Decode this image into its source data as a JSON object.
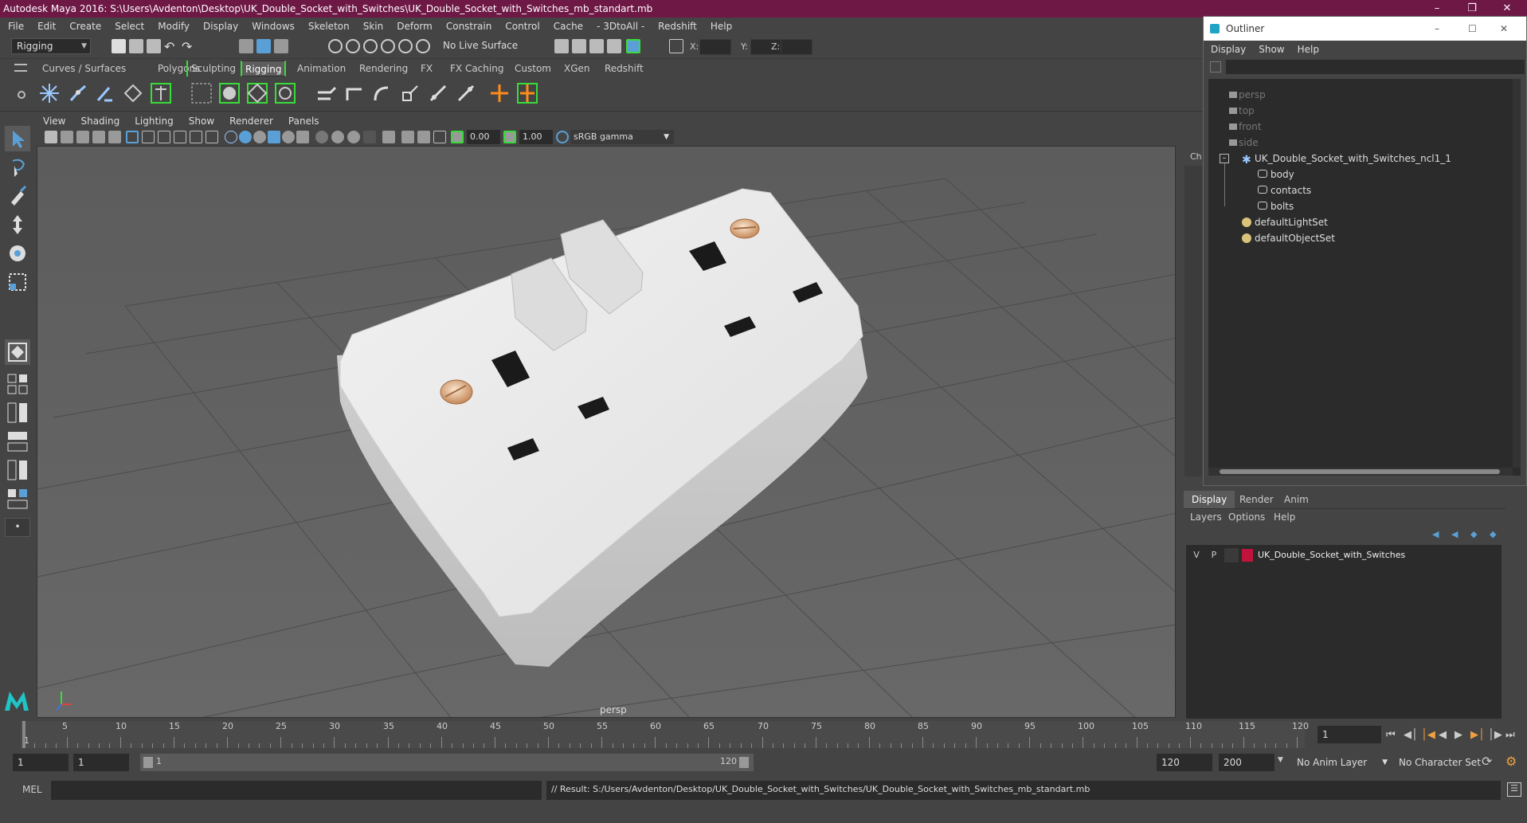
{
  "window": {
    "title": "Autodesk Maya 2016: S:\\Users\\Avdenton\\Desktop\\UK_Double_Socket_with_Switches\\UK_Double_Socket_with_Switches_mb_standart.mb"
  },
  "menubar": [
    "File",
    "Edit",
    "Create",
    "Select",
    "Modify",
    "Display",
    "Windows",
    "Skeleton",
    "Skin",
    "Deform",
    "Constrain",
    "Control",
    "Cache",
    "- 3DtoAll -",
    "Redshift",
    "Help"
  ],
  "statusline": {
    "mode": "Rigging",
    "live_surface": "No Live Surface",
    "x_label": "X:",
    "y_label": "Y:",
    "z_label": "Z:"
  },
  "shelf": {
    "tabs": [
      "Curves / Surfaces",
      "Polygons",
      "Sculpting",
      "Rigging",
      "Animation",
      "Rendering",
      "FX",
      "FX Caching",
      "Custom",
      "XGen",
      "Redshift"
    ],
    "active": "Rigging"
  },
  "panel": {
    "menu": [
      "View",
      "Shading",
      "Lighting",
      "Show",
      "Renderer",
      "Panels"
    ],
    "exposure": "0.00",
    "gamma": "1.00",
    "color_space": "sRGB gamma",
    "camera_label": "persp"
  },
  "outliner": {
    "title": "Outliner",
    "menu": [
      "Display",
      "Show",
      "Help"
    ],
    "items": [
      {
        "label": "persp",
        "dim": true,
        "indent": 0
      },
      {
        "label": "top",
        "dim": true,
        "indent": 0
      },
      {
        "label": "front",
        "dim": true,
        "indent": 0
      },
      {
        "label": "side",
        "dim": true,
        "indent": 0
      },
      {
        "label": "UK_Double_Socket_with_Switches_ncl1_1",
        "dim": false,
        "indent": 0
      },
      {
        "label": "body",
        "dim": false,
        "indent": 1
      },
      {
        "label": "contacts",
        "dim": false,
        "indent": 1
      },
      {
        "label": "bolts",
        "dim": false,
        "indent": 1
      },
      {
        "label": "defaultLightSet",
        "dim": false,
        "indent": 0
      },
      {
        "label": "defaultObjectSet",
        "dim": false,
        "indent": 0
      }
    ]
  },
  "channel_stub": "Ch",
  "layer_editor": {
    "tabs": [
      "Display",
      "Render",
      "Anim"
    ],
    "active": "Display",
    "menu": [
      "Layers",
      "Options",
      "Help"
    ],
    "layer": {
      "v": "V",
      "p": "P",
      "name": "UK_Double_Socket_with_Switches",
      "color": "#c0143c"
    }
  },
  "timeline": {
    "ticks": [
      "5",
      "10",
      "15",
      "20",
      "25",
      "30",
      "35",
      "40",
      "45",
      "50",
      "55",
      "60",
      "65",
      "70",
      "75",
      "80",
      "85",
      "90",
      "95",
      "100",
      "105",
      "110",
      "115",
      "120"
    ],
    "start_mark": "1",
    "current_frame": "1"
  },
  "range": {
    "start": "1",
    "start2": "1",
    "range_start": "1",
    "range_end": "120",
    "end": "120",
    "end2": "200",
    "anim_layer": "No Anim Layer",
    "char_set": "No Character Set"
  },
  "cmdline": {
    "lang": "MEL",
    "result": "// Result: S:/Users/Avdenton/Desktop/UK_Double_Socket_with_Switches/UK_Double_Socket_with_Switches_mb_standart.mb"
  },
  "colors": {
    "title_bar": "#6e1846",
    "accent_green": "#3adb3a",
    "highlight_blue": "#5aa0d6"
  }
}
